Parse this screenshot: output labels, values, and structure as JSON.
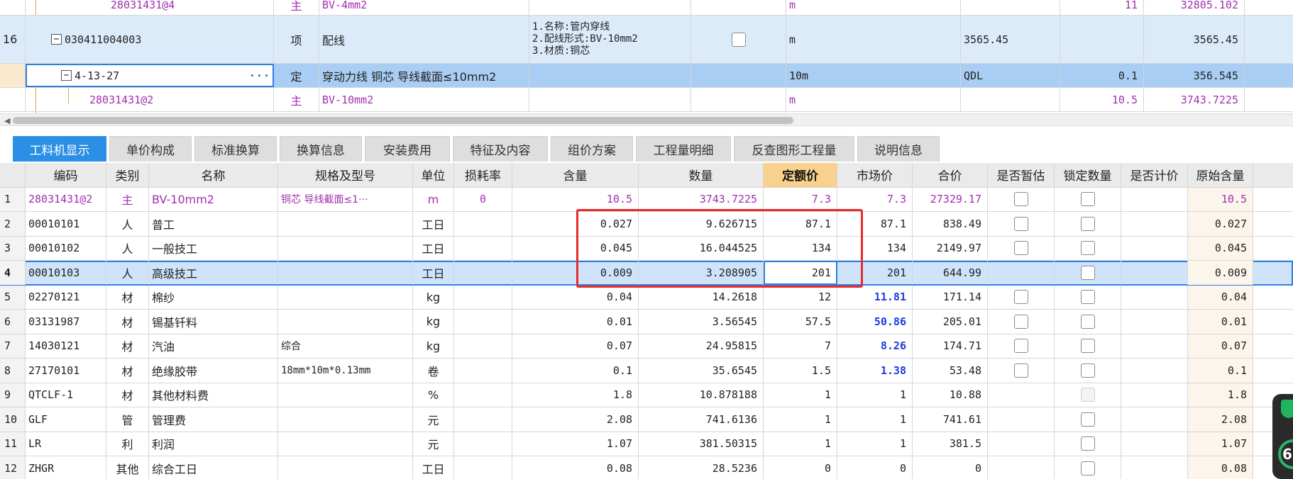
{
  "top_rows": [
    {
      "index": "",
      "code": "28031431@4",
      "type": "主",
      "name": "BV-4mm2",
      "features": [],
      "unit": "m",
      "qty": "",
      "qty2": "11",
      "amount": "32805.102"
    },
    {
      "index": "16",
      "code": "030411004003",
      "type": "项",
      "name": "配线",
      "features": [
        "1.名称:管内穿线",
        "2.配线形式:BV-10mm2",
        "3.材质:铜芯"
      ],
      "unit": "m",
      "qty": "3565.45",
      "qty2": "",
      "amount": "3565.45"
    },
    {
      "index": "",
      "code": "4-13-27",
      "type": "定",
      "name": "穿动力线 铜芯 导线截面≤10mm2",
      "features": [],
      "unit": "10m",
      "qty": "QDL",
      "qty2": "0.1",
      "amount": "356.545"
    },
    {
      "index": "",
      "code": "28031431@2",
      "type": "主",
      "name": "BV-10mm2",
      "features": [],
      "unit": "m",
      "qty": "",
      "qty2": "10.5",
      "amount": "3743.7225"
    }
  ],
  "tabs": [
    "工料机显示",
    "单价构成",
    "标准换算",
    "换算信息",
    "安装费用",
    "特征及内容",
    "组价方案",
    "工程量明细",
    "反查图形工程量",
    "说明信息"
  ],
  "columns": [
    "编码",
    "类别",
    "名称",
    "规格及型号",
    "单位",
    "损耗率",
    "含量",
    "数量",
    "定额价",
    "市场价",
    "合价",
    "是否暂估",
    "锁定数量",
    "是否计价",
    "原始含量"
  ],
  "rows": [
    {
      "no": "1",
      "code": "28031431@2",
      "type": "主",
      "name": "BV-10mm2",
      "spec": "铜芯 导线截面≤1···",
      "unit": "m",
      "loss": "0",
      "content": "10.5",
      "qty": "3743.7225",
      "quota": "7.3",
      "market": "7.3",
      "total": "27329.17",
      "orig": "10.5"
    },
    {
      "no": "2",
      "code": "00010101",
      "type": "人",
      "name": "普工",
      "spec": "",
      "unit": "工日",
      "loss": "",
      "content": "0.027",
      "qty": "9.626715",
      "quota": "87.1",
      "market": "87.1",
      "total": "838.49",
      "orig": "0.027"
    },
    {
      "no": "3",
      "code": "00010102",
      "type": "人",
      "name": "一般技工",
      "spec": "",
      "unit": "工日",
      "loss": "",
      "content": "0.045",
      "qty": "16.044525",
      "quota": "134",
      "market": "134",
      "total": "2149.97",
      "orig": "0.045"
    },
    {
      "no": "4",
      "code": "00010103",
      "type": "人",
      "name": "高级技工",
      "spec": "",
      "unit": "工日",
      "loss": "",
      "content": "0.009",
      "qty": "3.208905",
      "quota": "201",
      "market": "201",
      "total": "644.99",
      "orig": "0.009"
    },
    {
      "no": "5",
      "code": "02270121",
      "type": "材",
      "name": "棉纱",
      "spec": "",
      "unit": "kg",
      "loss": "",
      "content": "0.04",
      "qty": "14.2618",
      "quota": "12",
      "market": "11.81",
      "total": "171.14",
      "orig": "0.04"
    },
    {
      "no": "6",
      "code": "03131987",
      "type": "材",
      "name": "锡基钎料",
      "spec": "",
      "unit": "kg",
      "loss": "",
      "content": "0.01",
      "qty": "3.56545",
      "quota": "57.5",
      "market": "50.86",
      "total": "205.01",
      "orig": "0.01"
    },
    {
      "no": "7",
      "code": "14030121",
      "type": "材",
      "name": "汽油",
      "spec": "综合",
      "unit": "kg",
      "loss": "",
      "content": "0.07",
      "qty": "24.95815",
      "quota": "7",
      "market": "8.26",
      "total": "174.71",
      "orig": "0.07"
    },
    {
      "no": "8",
      "code": "27170101",
      "type": "材",
      "name": "绝缘胶带",
      "spec": "18mm*10m*0.13mm",
      "unit": "卷",
      "loss": "",
      "content": "0.1",
      "qty": "35.6545",
      "quota": "1.5",
      "market": "1.38",
      "total": "53.48",
      "orig": "0.1"
    },
    {
      "no": "9",
      "code": "QTCLF-1",
      "type": "材",
      "name": "其他材料费",
      "spec": "",
      "unit": "%",
      "loss": "",
      "content": "1.8",
      "qty": "10.878188",
      "quota": "1",
      "market": "1",
      "total": "10.88",
      "orig": "1.8"
    },
    {
      "no": "10",
      "code": "GLF",
      "type": "管",
      "name": "管理费",
      "spec": "",
      "unit": "元",
      "loss": "",
      "content": "2.08",
      "qty": "741.6136",
      "quota": "1",
      "market": "1",
      "total": "741.61",
      "orig": "2.08"
    },
    {
      "no": "11",
      "code": "LR",
      "type": "利",
      "name": "利润",
      "spec": "",
      "unit": "元",
      "loss": "",
      "content": "1.07",
      "qty": "381.50315",
      "quota": "1",
      "market": "1",
      "total": "381.5",
      "orig": "1.07"
    },
    {
      "no": "12",
      "code": "ZHGR",
      "type": "其他",
      "name": "综合工日",
      "spec": "",
      "unit": "工日",
      "loss": "",
      "content": "0.08",
      "qty": "28.5236",
      "quota": "0",
      "market": "0",
      "total": "0",
      "orig": "0.08"
    }
  ],
  "widget": {
    "gauge_text": "6("
  },
  "colors": {
    "purple": "#a22fb0",
    "tab_active": "#2b8fe6",
    "highlight_header": "#f7d18d",
    "red_box": "#e62b2b",
    "market_changed": "#1a3be0"
  }
}
